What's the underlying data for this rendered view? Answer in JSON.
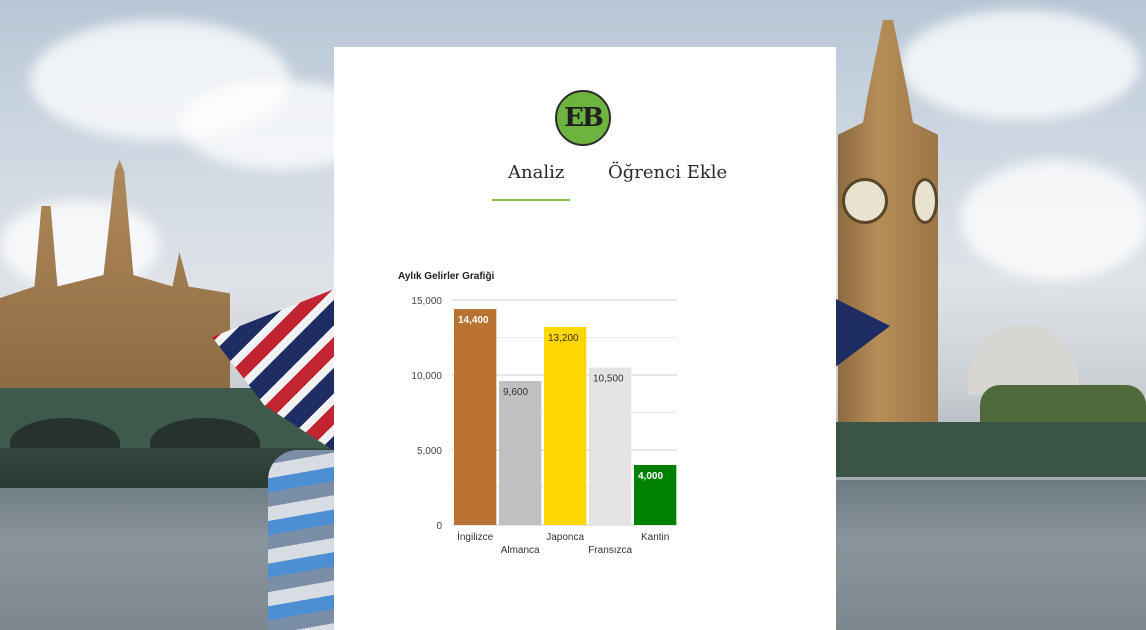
{
  "logo": {
    "text": "EB"
  },
  "tabs": [
    {
      "label": "Analiz",
      "active": true
    },
    {
      "label": "Öğrenci Ekle",
      "active": false
    }
  ],
  "colors": {
    "accent": "#8bc34a",
    "logo_bg": "#6db33f"
  },
  "chart_data": {
    "type": "bar",
    "title": "Aylık Gelirler Grafiği",
    "categories": [
      "İngilizce",
      "Almanca",
      "Japonca",
      "Fransızca",
      "Kantin"
    ],
    "values": [
      14400,
      9600,
      13200,
      10500,
      4000
    ],
    "data_labels": [
      "14,400",
      "9,600",
      "13,200",
      "10,500",
      "4,000"
    ],
    "bar_colors": [
      "#b87333",
      "#c0c0c0",
      "#ffd700",
      "#e5e4e2",
      "#008000"
    ],
    "label_colors": [
      "#ffffff",
      "#333333",
      "#333333",
      "#333333",
      "#ffffff"
    ],
    "ylim": [
      0,
      15000
    ],
    "yticks": [
      0,
      5000,
      10000,
      15000
    ],
    "ytick_labels": [
      "0",
      "5,000",
      "10,000",
      "15,000"
    ],
    "grid": true,
    "legend": "none"
  }
}
